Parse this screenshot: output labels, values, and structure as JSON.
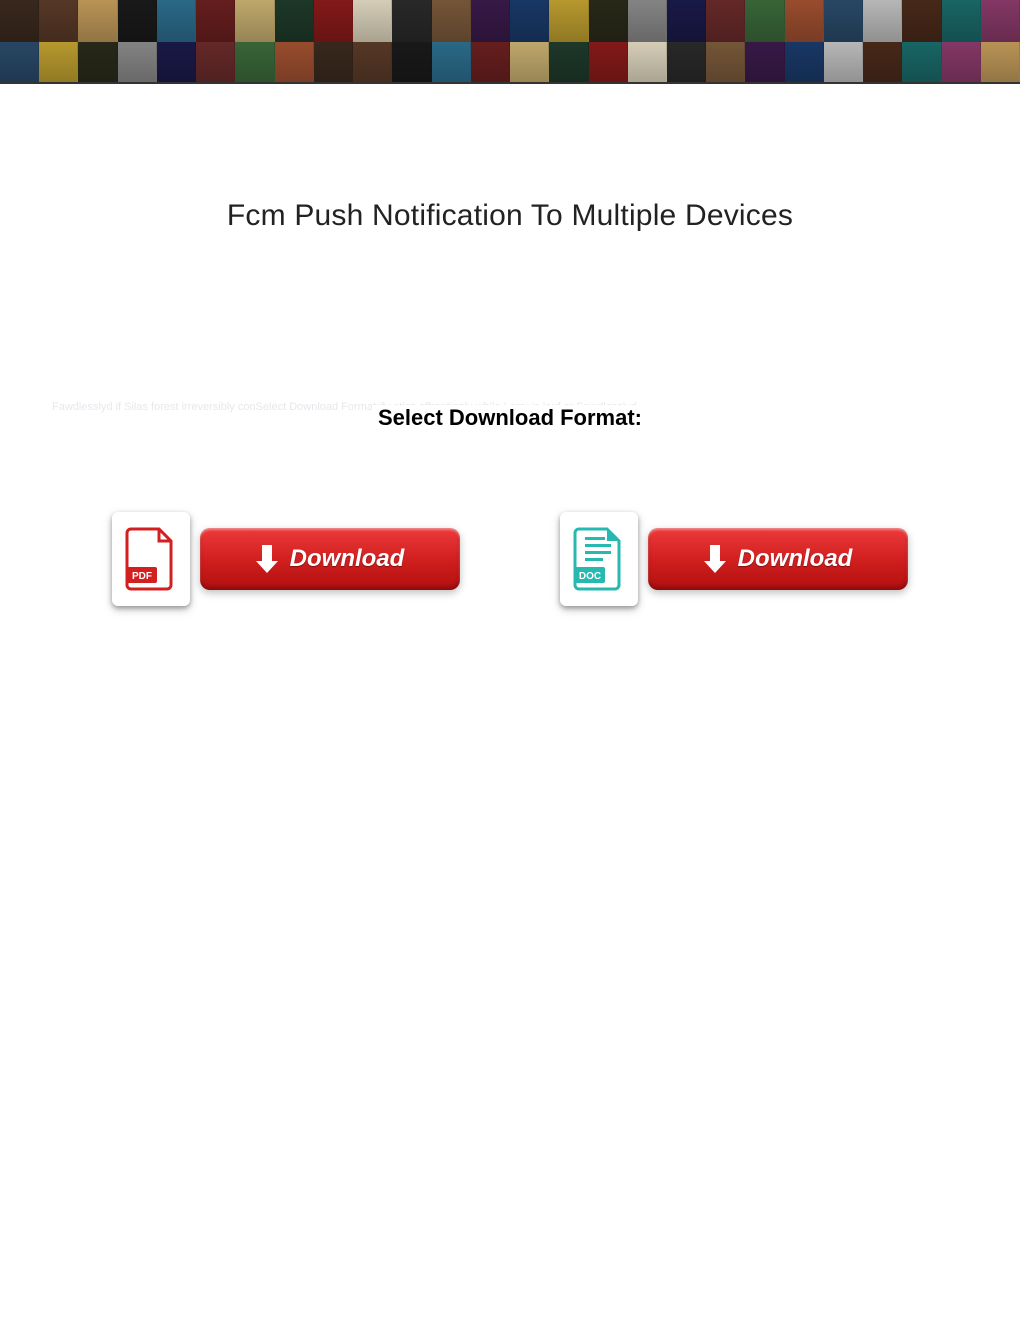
{
  "banner": {
    "rows": [
      [
        "#3b2a1e",
        "#5a3a28",
        "#c29b5a",
        "#1a1a1a",
        "#2c6e8e",
        "#6b1f1f",
        "#c8b070",
        "#1e3a2a",
        "#8a1a1a",
        "#e0d8c0",
        "#2a2a2a",
        "#7a5a3a",
        "#3a1a4a",
        "#1a3a6a",
        "#c0a030",
        "#2a2a1a",
        "#8a8a8a",
        "#1a1a4a",
        "#6a2a2a",
        "#3a6a3a",
        "#a05030",
        "#2a4a6a",
        "#c0c0c0",
        "#4a2a1a",
        "#1a6a6a",
        "#8a3a6a"
      ],
      [
        "#2a4a6a",
        "#c0a030",
        "#2a2a1a",
        "#8a8a8a",
        "#1a1a4a",
        "#6a2a2a",
        "#3a6a3a",
        "#a05030",
        "#3b2a1e",
        "#5a3a28",
        "#1a1a1a",
        "#2c6e8e",
        "#6b1f1f",
        "#c8b070",
        "#1e3a2a",
        "#8a1a1a",
        "#e0d8c0",
        "#2a2a2a",
        "#7a5a3a",
        "#3a1a4a",
        "#1a3a6a",
        "#c0c0c0",
        "#4a2a1a",
        "#1a6a6a",
        "#8a3a6a",
        "#c29b5a"
      ]
    ]
  },
  "page": {
    "title": "Fcm Push Notification To Multiple Devices"
  },
  "format": {
    "label": "Select Download Format:",
    "faded_text": "Fawdlesslyd if Silas forest irreversibly conSelect Download Format:ify atics affrontingly while Larry is lauf or Fawdlesslyd"
  },
  "downloads": {
    "pdf": {
      "badge": "PDF",
      "button_label": "Download",
      "icon_color": "#d21f1f"
    },
    "doc": {
      "badge": "DOC",
      "button_label": "Download",
      "icon_color": "#27b8b0"
    }
  }
}
